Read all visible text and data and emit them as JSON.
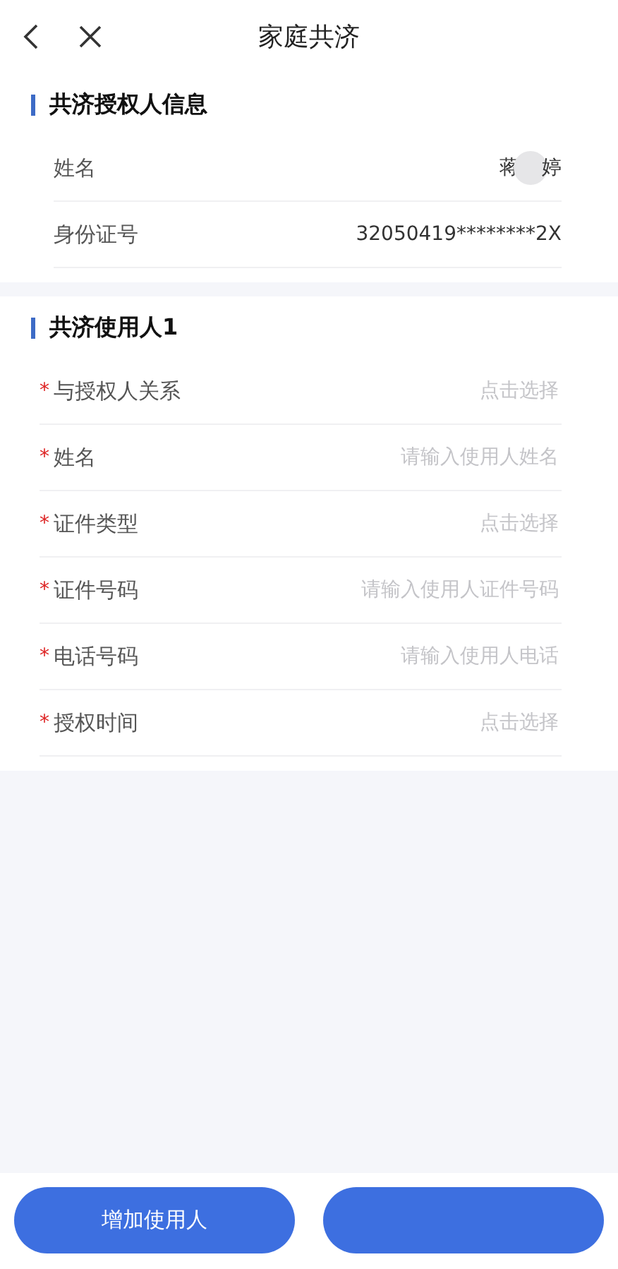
{
  "header": {
    "title": "家庭共济"
  },
  "authorizer": {
    "title": "共济授权人信息",
    "rows": [
      {
        "kind": "name",
        "label": "姓名",
        "value_parts": [
          "蒋",
          "婷"
        ]
      },
      {
        "kind": "text",
        "label": "身份证号",
        "value": "32050419********2X"
      }
    ]
  },
  "user": {
    "title": "共济使用人1",
    "fields": [
      {
        "required_mark": "*",
        "label": "与授权人关系",
        "placeholder": "点击选择"
      },
      {
        "required_mark": "*",
        "label": "姓名",
        "placeholder": "请输入使用人姓名"
      },
      {
        "required_mark": "*",
        "label": "证件类型",
        "placeholder": "点击选择"
      },
      {
        "required_mark": "*",
        "label": "证件号码",
        "placeholder": "请输入使用人证件号码"
      },
      {
        "required_mark": "*",
        "label": "电话号码",
        "placeholder": "请输入使用人电话"
      },
      {
        "required_mark": "*",
        "label": "授权时间",
        "placeholder": "点击选择"
      }
    ]
  },
  "buttons": [
    {
      "kind": "add",
      "label": "增加使用人"
    },
    {
      "kind": "submit"
    }
  ]
}
